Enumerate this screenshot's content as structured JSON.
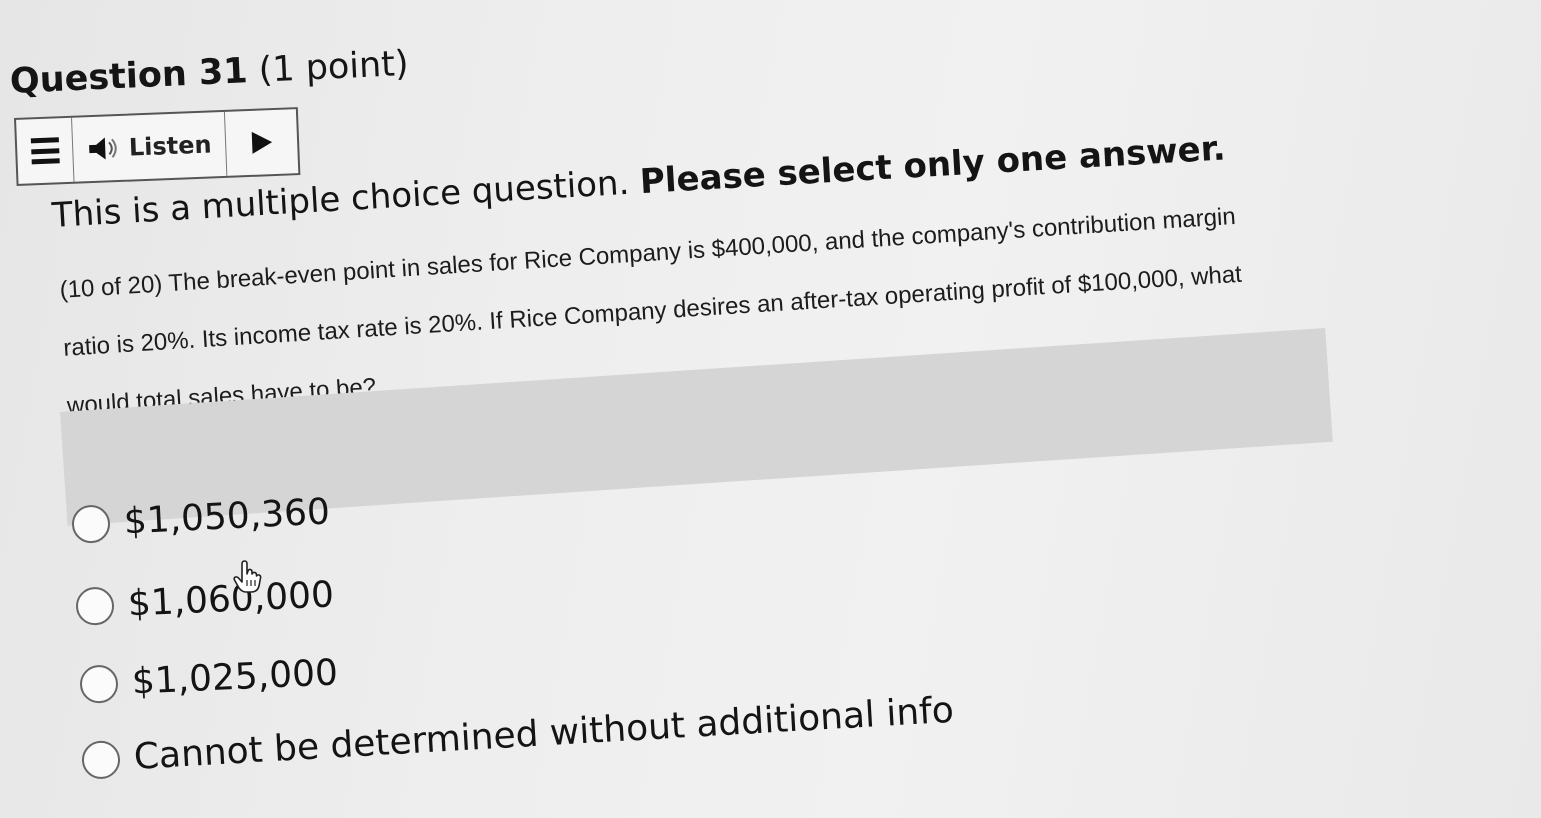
{
  "question": {
    "number_label": "Question 31",
    "points_label": "(1 point)"
  },
  "toolbar": {
    "menu_icon": "hamburger-menu-icon",
    "speaker_icon": "speaker-icon",
    "listen_label": "Listen",
    "play_icon": "play-icon"
  },
  "instruction": {
    "text_regular": "This is a multiple choice question. ",
    "text_bold": "Please select only one answer."
  },
  "body": {
    "line1": "(10 of 20) The break-even point in sales for Rice Company is $400,000, and the company's contribution margin",
    "line2": "ratio is 20%. Its income tax rate is 20%. If Rice Company desires an after-tax operating profit of $100,000, what",
    "line3": "would total sales have to be?"
  },
  "options": [
    {
      "label": "$1,050,360"
    },
    {
      "label": "$1,060,000"
    },
    {
      "label": "$1,025,000"
    },
    {
      "label": "Cannot be determined without additional info"
    }
  ],
  "cursor_icon": "hand-pointer-icon"
}
